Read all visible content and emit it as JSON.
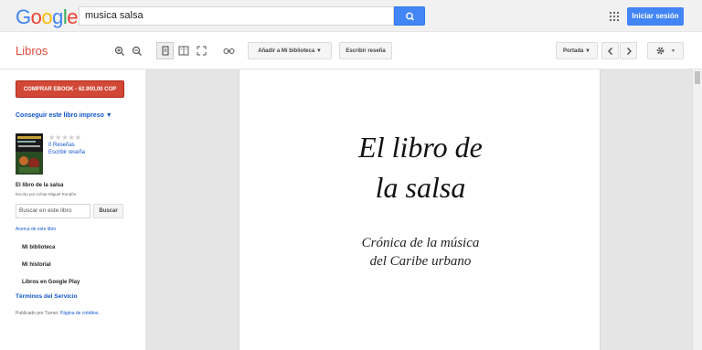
{
  "header": {
    "logo_letters": [
      {
        "ch": "G",
        "color": "#4285f4"
      },
      {
        "ch": "o",
        "color": "#ea4335"
      },
      {
        "ch": "o",
        "color": "#fbbc05"
      },
      {
        "ch": "g",
        "color": "#4285f4"
      },
      {
        "ch": "l",
        "color": "#34a853"
      },
      {
        "ch": "e",
        "color": "#ea4335"
      }
    ],
    "search_value": "musica salsa",
    "signin_label": "Iniciar sesión"
  },
  "toolbar": {
    "section_title": "Libros",
    "add_library_label": "Añadir a Mi biblioteca ▼",
    "write_review_label": "Escribir reseña",
    "portada_label": "Portada ▼",
    "settings_caret": "▼"
  },
  "sidebar": {
    "buy_label": "COMPRAR EBOOK - 62.900,00 COP",
    "print_link": "Conseguir este libro impreso ▼",
    "stars": "★★★★★",
    "reviews": "0 Reseñas",
    "write_review": "Escribir reseña",
    "book_title": "El libro de la salsa",
    "author": "Escrito por César Miguel Rondón",
    "search_placeholder": "Buscar en este libro",
    "search_button": "Buscar",
    "about_link": "Acerca de este libro",
    "nav_items": [
      "Mi biblioteca",
      "Mi historial",
      "Libros en Google Play"
    ],
    "terms": "Términos del Servicio",
    "published_prefix": "Publicado por Turner.",
    "credits_link": "Página de créditos."
  },
  "page": {
    "title_line1": "El libro de",
    "title_line2": "la salsa",
    "subtitle_line1": "Crónica de la música",
    "subtitle_line2": "del Caribe urbano"
  },
  "colors": {
    "accent_blue": "#4285f4",
    "libros_red": "#dd4b39",
    "buy_red": "#d14836",
    "link_blue": "#1155cc"
  },
  "icons": [
    "search-icon",
    "apps-grid-icon",
    "zoom-in-icon",
    "zoom-out-icon",
    "single-page-icon",
    "two-page-icon",
    "fullscreen-icon",
    "link-icon",
    "chevron-left-icon",
    "chevron-right-icon",
    "gear-icon"
  ]
}
